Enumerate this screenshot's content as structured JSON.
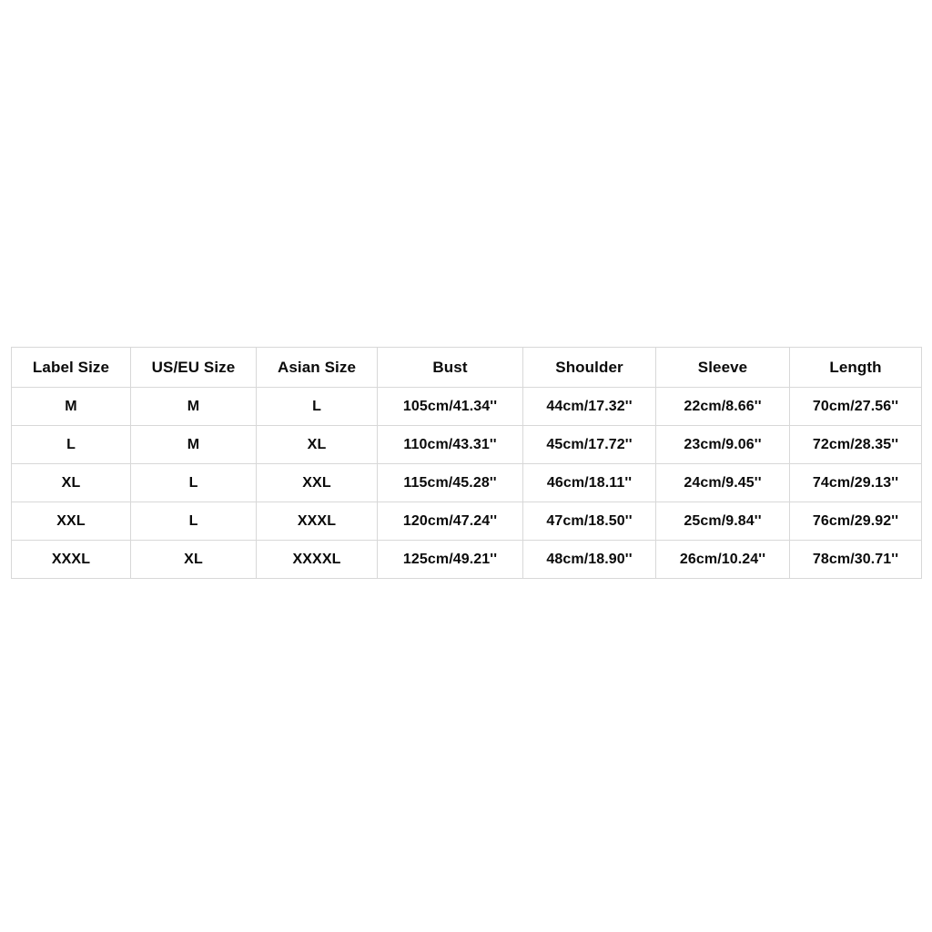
{
  "page": {
    "background_color": "#ffffff",
    "text_color": "#0a0a0a",
    "border_color": "#d8d8d8"
  },
  "size_chart": {
    "columns": [
      "Label Size",
      "US/EU Size",
      "Asian Size",
      "Bust",
      "Shoulder",
      "Sleeve",
      "Length"
    ],
    "rows": [
      [
        "M",
        "M",
        "L",
        "105cm/41.34''",
        "44cm/17.32''",
        "22cm/8.66''",
        "70cm/27.56''"
      ],
      [
        "L",
        "M",
        "XL",
        "110cm/43.31''",
        "45cm/17.72''",
        "23cm/9.06''",
        "72cm/28.35''"
      ],
      [
        "XL",
        "L",
        "XXL",
        "115cm/45.28''",
        "46cm/18.11''",
        "24cm/9.45''",
        "74cm/29.13''"
      ],
      [
        "XXL",
        "L",
        "XXXL",
        "120cm/47.24''",
        "47cm/18.50''",
        "25cm/9.84''",
        "76cm/29.92''"
      ],
      [
        "XXXL",
        "XL",
        "XXXXL",
        "125cm/49.21''",
        "48cm/18.90''",
        "26cm/10.24''",
        "78cm/30.71''"
      ]
    ]
  }
}
